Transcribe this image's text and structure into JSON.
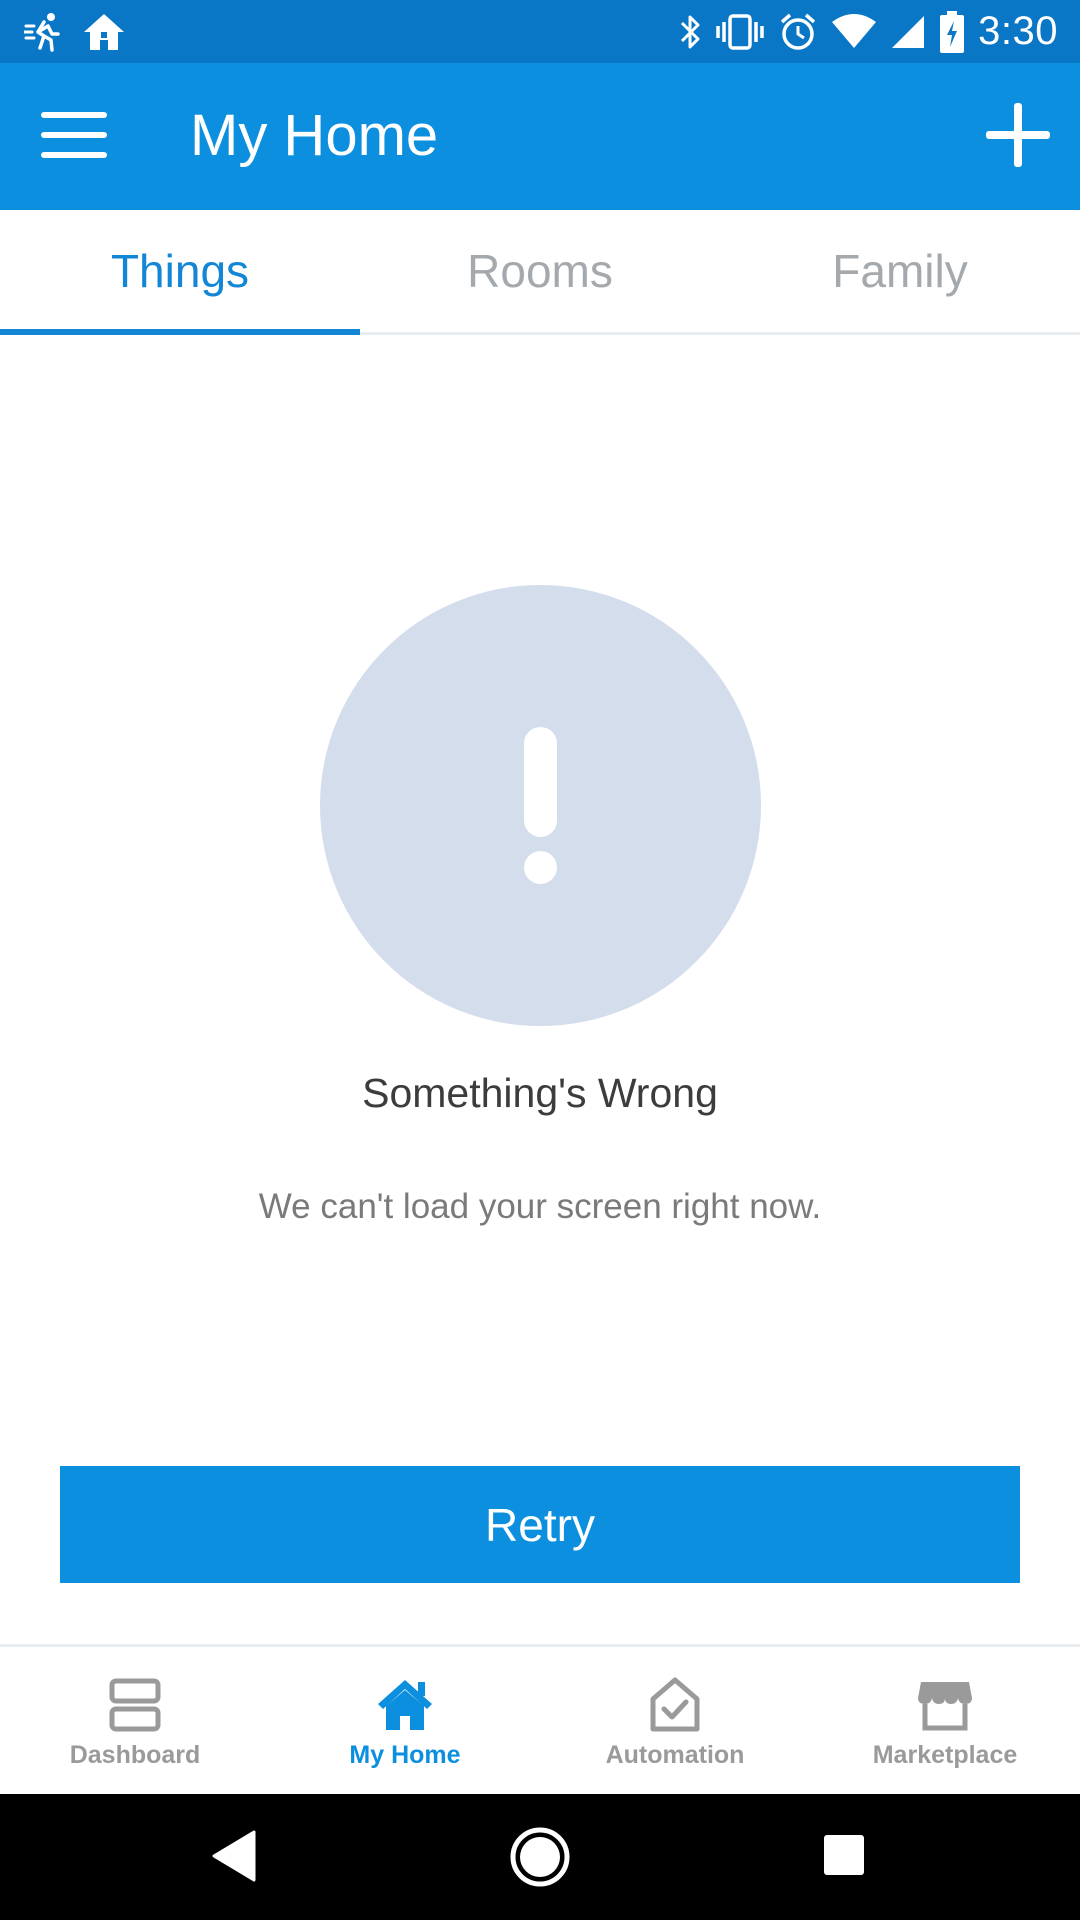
{
  "status_bar": {
    "time": "3:30",
    "left_icons": [
      "activity-icon",
      "home-notification-icon"
    ],
    "right_icons": [
      "bluetooth-icon",
      "vibrate-icon",
      "alarm-icon",
      "wifi-icon",
      "signal-icon",
      "battery-charging-icon"
    ]
  },
  "app_bar": {
    "title": "My Home",
    "menu_icon": "hamburger-menu-icon",
    "add_icon": "plus-icon"
  },
  "tabs": [
    {
      "label": "Things",
      "active": true
    },
    {
      "label": "Rooms",
      "active": false
    },
    {
      "label": "Family",
      "active": false
    }
  ],
  "error": {
    "icon": "exclamation-icon",
    "title": "Something's Wrong",
    "message": "We can't load your screen right now."
  },
  "retry": {
    "label": "Retry"
  },
  "bottom_nav": [
    {
      "label": "Dashboard",
      "icon": "dashboard-icon",
      "active": false
    },
    {
      "label": "My Home",
      "icon": "home-icon",
      "active": true
    },
    {
      "label": "Automation",
      "icon": "automation-icon",
      "active": false
    },
    {
      "label": "Marketplace",
      "icon": "marketplace-icon",
      "active": false
    }
  ],
  "system_nav": [
    "back-icon",
    "home-button-icon",
    "recents-icon"
  ],
  "colors": {
    "primary": "#0d8fdf",
    "status_bar": "#0a76c6",
    "tab_active": "#1486d6",
    "tab_inactive": "#a4a9ae",
    "error_circle": "#d4ddec",
    "nav_inactive": "#9a9a9a"
  }
}
